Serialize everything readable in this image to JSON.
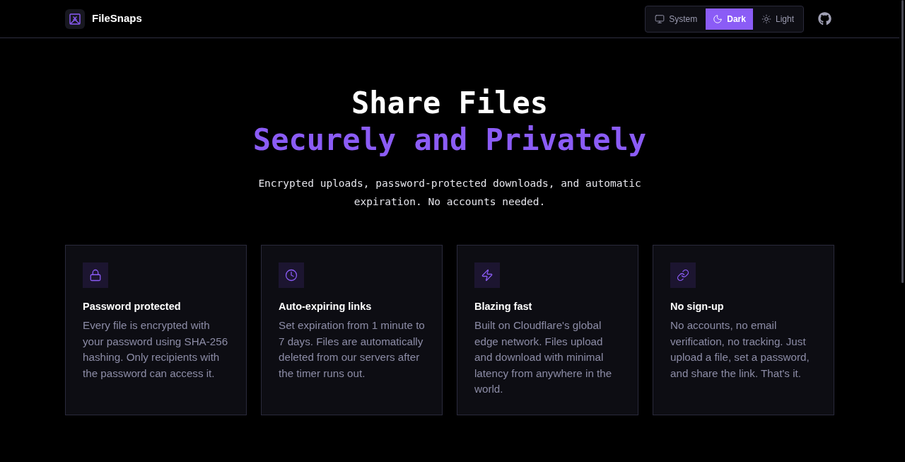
{
  "header": {
    "brand": "FileSnaps",
    "theme_options": [
      {
        "label": "System",
        "selected": false
      },
      {
        "label": "Dark",
        "selected": true
      },
      {
        "label": "Light",
        "selected": false
      }
    ]
  },
  "hero": {
    "title": "Share Files",
    "title_accent": "Securely and Privately",
    "subtitle": "Encrypted uploads, password-protected downloads, and automatic expiration. No accounts needed."
  },
  "features": [
    {
      "title": "Password protected",
      "description": "Every file is encrypted with your password using SHA-256 hashing. Only recipients with the password can access it."
    },
    {
      "title": "Auto-expiring links",
      "description": "Set expiration from 1 minute to 7 days. Files are automatically deleted from our servers after the timer runs out."
    },
    {
      "title": "Blazing fast",
      "description": "Built on Cloudflare's global edge network. Files upload and download with minimal latency from anywhere in the world."
    },
    {
      "title": "No sign-up",
      "description": "No accounts, no email verification, no tracking. Just upload a file, set a password, and share the link. That's it."
    }
  ]
}
